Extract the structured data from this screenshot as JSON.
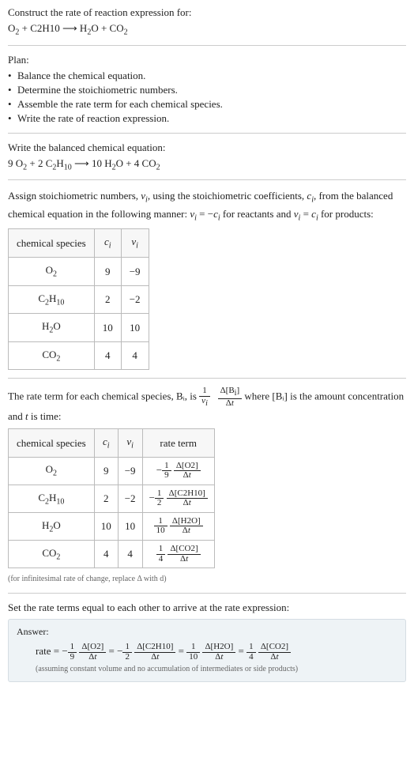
{
  "intro": {
    "title": "Construct the rate of reaction expression for:",
    "equation": "O₂ + C2H10 ⟶ H₂O + CO₂"
  },
  "plan": {
    "label": "Plan:",
    "items": [
      "Balance the chemical equation.",
      "Determine the stoichiometric numbers.",
      "Assemble the rate term for each chemical species.",
      "Write the rate of reaction expression."
    ]
  },
  "balanced": {
    "label": "Write the balanced chemical equation:",
    "equation": "9 O₂ + 2 C₂H₁₀ ⟶ 10 H₂O + 4 CO₂"
  },
  "stoich": {
    "intro": "Assign stoichiometric numbers, νᵢ, using the stoichiometric coefficients, cᵢ, from the balanced chemical equation in the following manner: νᵢ = −cᵢ for reactants and νᵢ = cᵢ for products:",
    "headers": [
      "chemical species",
      "cᵢ",
      "νᵢ"
    ],
    "rows": [
      {
        "s": "O₂",
        "c": "9",
        "v": "−9"
      },
      {
        "s": "C₂H₁₀",
        "c": "2",
        "v": "−2"
      },
      {
        "s": "H₂O",
        "c": "10",
        "v": "10"
      },
      {
        "s": "CO₂",
        "c": "4",
        "v": "4"
      }
    ]
  },
  "rateterm": {
    "intro_a": "The rate term for each chemical species, Bᵢ, is ",
    "intro_b": " where [Bᵢ] is the amount concentration and ",
    "intro_c": " is time:",
    "t": "t",
    "headers": [
      "chemical species",
      "cᵢ",
      "νᵢ",
      "rate term"
    ],
    "rows": [
      {
        "s": "O₂",
        "c": "9",
        "v": "−9",
        "rn": "1",
        "rd": "9",
        "sign": "−",
        "dn": "Δ[O2]"
      },
      {
        "s": "C₂H₁₀",
        "c": "2",
        "v": "−2",
        "rn": "1",
        "rd": "2",
        "sign": "−",
        "dn": "Δ[C2H10]"
      },
      {
        "s": "H₂O",
        "c": "10",
        "v": "10",
        "rn": "1",
        "rd": "10",
        "sign": "",
        "dn": "Δ[H2O]"
      },
      {
        "s": "CO₂",
        "c": "4",
        "v": "4",
        "rn": "1",
        "rd": "4",
        "sign": "",
        "dn": "Δ[CO2]"
      }
    ],
    "note": "(for infinitesimal rate of change, replace Δ with d)",
    "dt": "Δt",
    "gen_frac1_num": "1",
    "gen_frac1_den": "νᵢ",
    "gen_frac2_num": "Δ[Bᵢ]",
    "gen_frac2_den": "Δt"
  },
  "final": {
    "label": "Set the rate terms equal to each other to arrive at the rate expression:",
    "answer_label": "Answer:",
    "rate_word": "rate = ",
    "expr": "− (1/9) Δ[O2]/Δt = − (1/2) Δ[C2H10]/Δt = (1/10) Δ[H2O]/Δt = (1/4) Δ[CO2]/Δt",
    "note": "(assuming constant volume and no accumulation of intermediates or side products)",
    "terms": [
      {
        "sign": "−",
        "n": "1",
        "d": "9",
        "dn": "Δ[O2]"
      },
      {
        "sign": "−",
        "n": "1",
        "d": "2",
        "dn": "Δ[C2H10]"
      },
      {
        "sign": "",
        "n": "1",
        "d": "10",
        "dn": "Δ[H2O]"
      },
      {
        "sign": "",
        "n": "1",
        "d": "4",
        "dn": "Δ[CO2]"
      }
    ],
    "dt": "Δt"
  }
}
